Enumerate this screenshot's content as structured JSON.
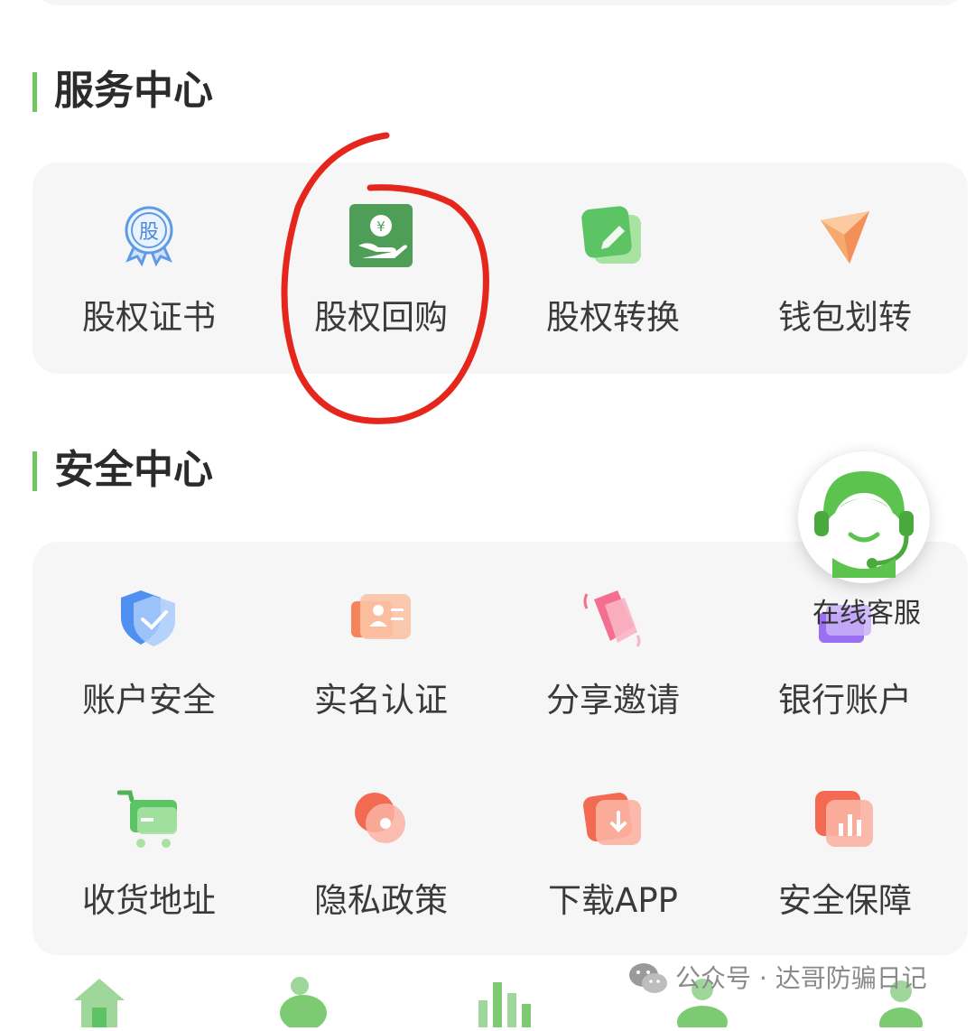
{
  "service_section": {
    "title": "服务中心",
    "items": [
      {
        "label": "股权证书",
        "icon": "equity-certificate-icon",
        "badge": "股"
      },
      {
        "label": "股权回购",
        "icon": "equity-buyback-icon"
      },
      {
        "label": "股权转换",
        "icon": "equity-conversion-icon"
      },
      {
        "label": "钱包划转",
        "icon": "wallet-transfer-icon"
      }
    ]
  },
  "security_section": {
    "title": "安全中心",
    "items": [
      {
        "label": "账户安全",
        "icon": "shield-icon"
      },
      {
        "label": "实名认证",
        "icon": "id-card-icon"
      },
      {
        "label": "分享邀请",
        "icon": "share-icon"
      },
      {
        "label": "银行账户",
        "icon": "bank-card-icon"
      },
      {
        "label": "收货地址",
        "icon": "shopping-cart-icon"
      },
      {
        "label": "隐私政策",
        "icon": "privacy-icon"
      },
      {
        "label": "下载APP",
        "icon": "download-icon"
      },
      {
        "label": "安全保障",
        "icon": "security-chart-icon"
      }
    ]
  },
  "customer_service": {
    "label": "在线客服",
    "icon": "headset-agent-icon"
  },
  "tabbar": {
    "icons": [
      "home-icon",
      "piggy-bank-icon",
      "chart-icon",
      "community-icon",
      "profile-icon"
    ]
  },
  "watermark": {
    "text": "公众号 · 达哥防骗日记",
    "icon": "wechat-icon"
  },
  "colors": {
    "accent": "#6cc75c",
    "card": "#f6f6f6",
    "annotation": "#e5261c"
  }
}
